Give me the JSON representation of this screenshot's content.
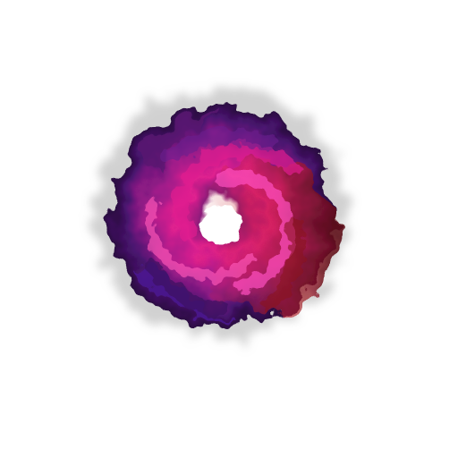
{
  "image": {
    "subject": "swirl-vortex",
    "background": "#ffffff",
    "palette": {
      "core": "#ffffff",
      "magenta": "#e0208f",
      "pink": "#ff4fc0",
      "purple": "#6a1f8f",
      "deep_violet": "#3a1060",
      "red": "#c8202a",
      "dark_red": "#5a0a18",
      "smoke": "#bdbdbd"
    }
  }
}
